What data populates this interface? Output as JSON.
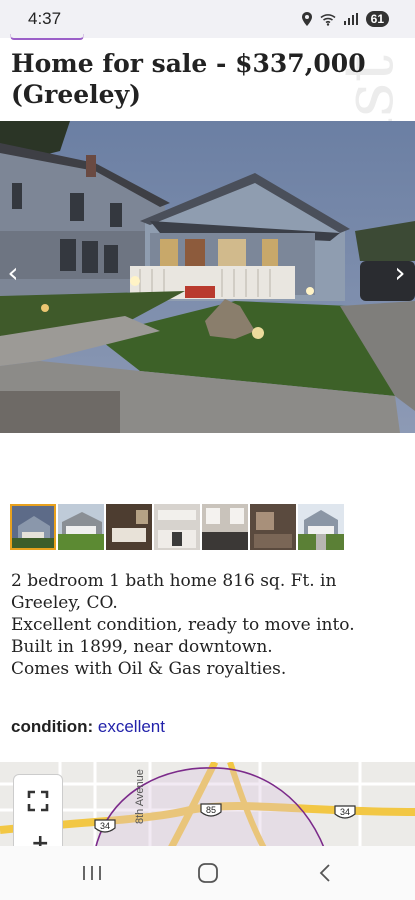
{
  "status_bar": {
    "time": "4:37",
    "battery": "61"
  },
  "listing": {
    "title": "Home for sale - $337,000 (Greeley)",
    "description_lines": [
      "2 bedroom 1 bath home 816 sq. Ft. in Greeley, CO.",
      "Excellent condition, ready to move into.",
      "Built in 1899, near downtown.",
      "Comes with Oil & Gas royalties."
    ],
    "condition_label": "condition:",
    "condition_value": "excellent"
  },
  "watermark": "craigslist",
  "gallery": {
    "prev_icon": "chevron-left-icon",
    "next_icon": "chevron-right-icon",
    "thumbnail_count": 7,
    "active_thumbnail": 1
  },
  "map": {
    "street_label": "8th Avenue",
    "route_labels": [
      "85",
      "34",
      "34"
    ],
    "controls": [
      "fullscreen-icon",
      "zoom-in-icon"
    ]
  },
  "nav_bar": {
    "buttons": [
      "recent-apps-icon",
      "home-icon",
      "back-icon"
    ]
  },
  "colors": {
    "link": "#2222aa",
    "thumb_active": "#e8a11e",
    "map_circle": "#7b2a8a",
    "highway": "#f2c744"
  }
}
